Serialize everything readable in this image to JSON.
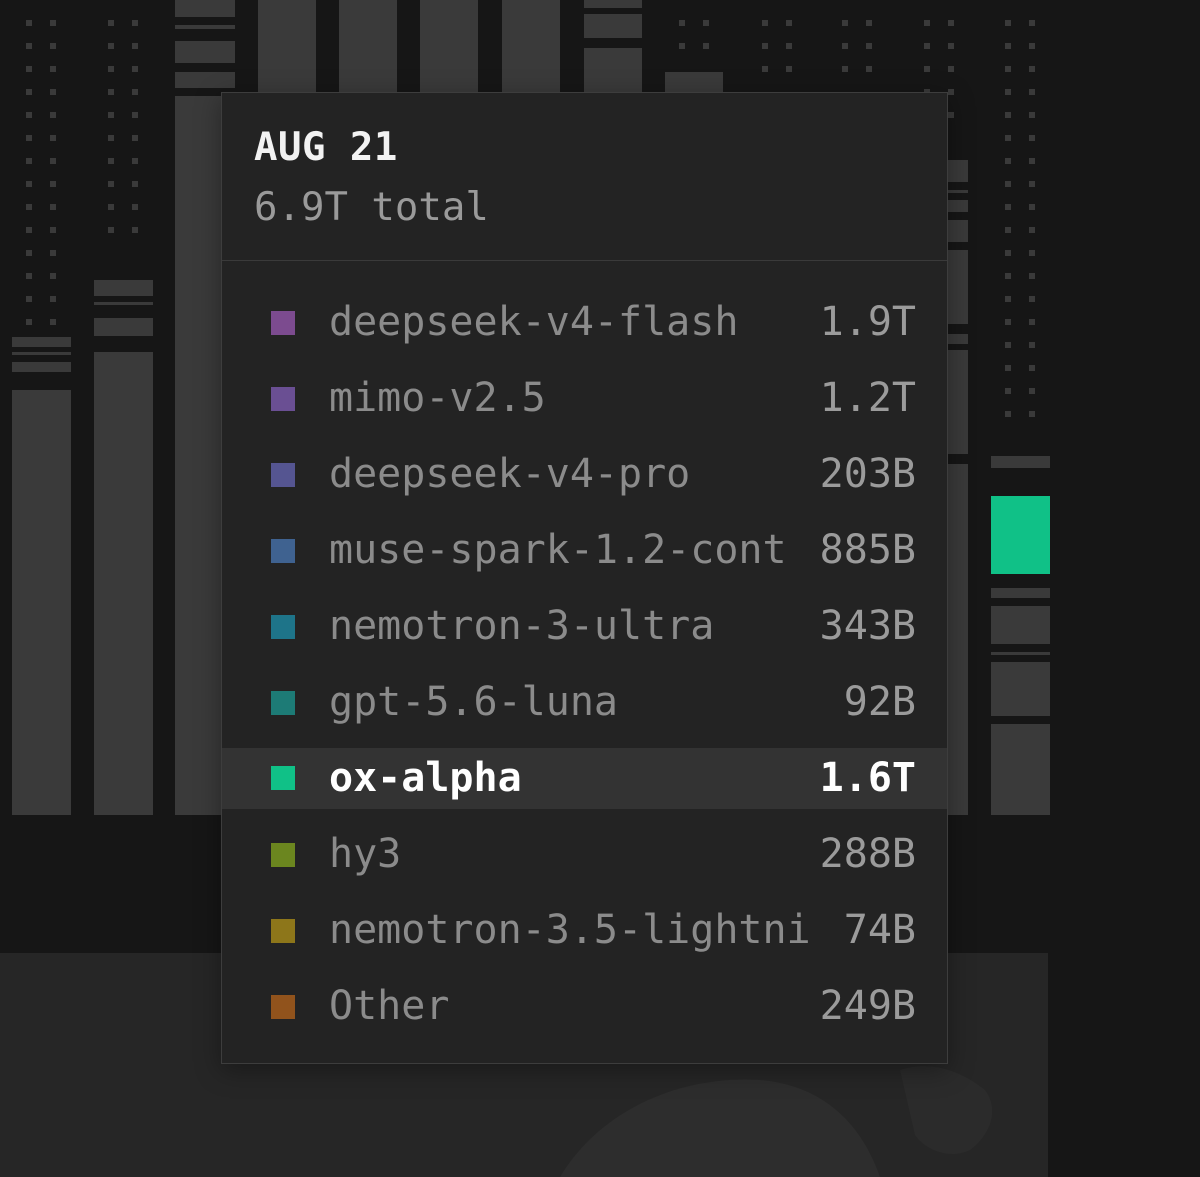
{
  "tooltip": {
    "date": "AUG 21",
    "total": "6.9T total",
    "rows": [
      {
        "name": "deepseek-v4-flash",
        "value": "1.9T",
        "color": "#7c4b8f",
        "active": false
      },
      {
        "name": "mimo-v2.5",
        "value": "1.2T",
        "color": "#6a4f93",
        "active": false
      },
      {
        "name": "deepseek-v4-pro",
        "value": "203B",
        "color": "#555591",
        "active": false
      },
      {
        "name": "muse-spark-1.2-cont",
        "value": "885B",
        "color": "#3f6290",
        "active": false
      },
      {
        "name": "nemotron-3-ultra",
        "value": "343B",
        "color": "#1e7489",
        "active": false
      },
      {
        "name": "gpt-5.6-luna",
        "value": "92B",
        "color": "#1d7b76",
        "active": false
      },
      {
        "name": "ox-alpha",
        "value": "1.6T",
        "color": "#10c187",
        "active": true
      },
      {
        "name": "hy3",
        "value": "288B",
        "color": "#6b861f",
        "active": false
      },
      {
        "name": "nemotron-3.5-lightni",
        "value": "74B",
        "color": "#8d761a",
        "active": false
      },
      {
        "name": "Other",
        "value": "249B",
        "color": "#91531c",
        "active": false
      }
    ]
  },
  "colors": {
    "bar": "#3a3a3a",
    "highlight": "#10c187",
    "tooltip_bg": "#232323",
    "page_bg": "#161616"
  }
}
